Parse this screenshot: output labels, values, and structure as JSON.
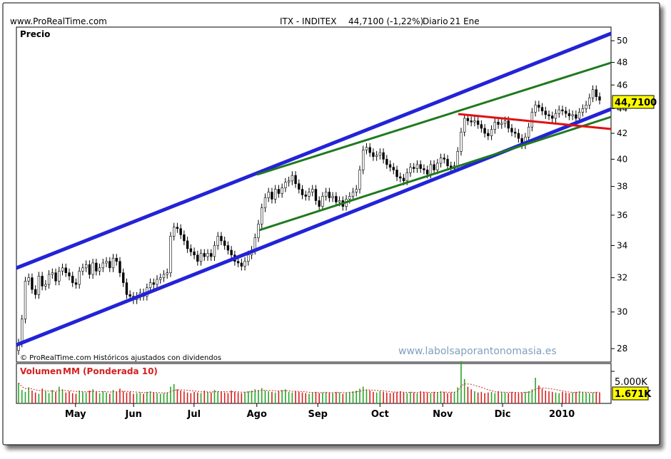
{
  "header": {
    "site": "www.ProRealTime.com",
    "title": "ITX - INDITEX",
    "quote": "44,7100 (-1,22%)",
    "period": "Diario",
    "date": "21 Ene"
  },
  "price_panel": {
    "label": "Precio",
    "footer_note": "© ProRealTime.com Históricos ajustados con dividendos",
    "watermark": "www.labolsaporantonomasia.es",
    "last_price_label": "44,7100"
  },
  "volume_panel": {
    "label_prefix": "Volumen",
    "label_ma": "MM (Ponderada 10)",
    "scale_top": "5.000K",
    "last_label": "1.671K"
  },
  "colors": {
    "up": "#2aa52a",
    "down": "#d42020",
    "channel_outer": "#2323d6",
    "channel_inner": "#1e7a1e",
    "resistance": "#e01010",
    "last_price_bg": "#ffff00"
  },
  "chart_data": [
    {
      "type": "candlestick",
      "title": "",
      "ylabel": "Precio",
      "yticks": [
        28,
        30,
        32,
        34,
        36,
        38,
        40,
        42,
        44,
        46,
        48,
        50
      ],
      "ylim": [
        27.3,
        51.3
      ],
      "y_scale": "log",
      "x_tick_labels": [
        "May",
        "Jun",
        "Jul",
        "Ago",
        "Sep",
        "Oct",
        "Nov",
        "Dic",
        "2010"
      ],
      "last_price": 44.71,
      "grid": false,
      "series": [
        {
          "values": [
            28.3,
            29.6,
            31.8,
            32.0,
            31.3,
            31.0,
            32.1,
            31.5,
            31.6,
            32.2,
            32.3,
            31.8,
            32.4,
            32.6,
            32.3,
            32.1,
            31.7,
            31.6,
            32.4,
            32.6,
            32.8,
            32.2,
            32.9,
            32.4,
            32.6,
            32.9,
            33.0,
            32.6,
            33.2,
            33.0,
            32.3,
            31.7,
            31.0,
            30.9,
            30.7,
            30.9,
            31.1,
            30.9,
            31.4,
            31.7,
            31.6,
            31.9,
            32.0,
            32.2,
            32.3,
            34.6,
            35.2,
            35.1,
            34.7,
            34.3,
            33.8,
            33.6,
            33.4,
            33.0,
            33.5,
            33.3,
            33.5,
            33.3,
            34.0,
            34.6,
            34.3,
            34.0,
            33.7,
            33.4,
            33.0,
            32.9,
            32.7,
            33.0,
            33.4,
            33.7,
            34.5,
            35.4,
            36.5,
            37.2,
            37.6,
            37.1,
            37.8,
            37.5,
            37.9,
            38.3,
            38.4,
            38.8,
            38.2,
            37.8,
            37.4,
            37.3,
            37.6,
            37.8,
            37.0,
            36.6,
            37.3,
            37.6,
            37.2,
            37.3,
            36.9,
            37.0,
            36.6,
            37.1,
            37.3,
            37.6,
            37.8,
            39.2,
            40.7,
            40.9,
            40.5,
            40.2,
            40.3,
            40.5,
            40.0,
            39.6,
            39.4,
            39.2,
            38.7,
            38.6,
            38.4,
            39.0,
            39.4,
            39.3,
            39.6,
            39.3,
            39.2,
            38.9,
            39.6,
            39.2,
            39.7,
            40.1,
            40.0,
            39.5,
            39.3,
            39.5,
            40.6,
            42.1,
            43.2,
            43.0,
            42.9,
            43.0,
            42.7,
            42.4,
            42.0,
            41.8,
            42.3,
            42.9,
            42.7,
            42.8,
            43.0,
            42.4,
            42.1,
            42.0,
            41.6,
            41.1,
            41.7,
            42.5,
            43.7,
            44.3,
            44.1,
            43.8,
            43.5,
            43.4,
            43.2,
            43.6,
            43.9,
            43.8,
            43.6,
            43.4,
            43.5,
            43.2,
            43.7,
            44.0,
            44.3,
            44.9,
            45.6,
            45.0,
            44.71
          ]
        }
      ]
    },
    {
      "type": "bar",
      "title": "",
      "ylabel": "Volumen",
      "ylim": [
        0,
        6000
      ],
      "yticks": [
        5000
      ],
      "unit": "K",
      "last_value": 1671,
      "series": [
        {
          "name": "MM (Ponderada 10)",
          "values": [
            3200,
            2100,
            1800,
            2500,
            2000,
            1700,
            1500,
            2300,
            1900,
            1600,
            2100,
            1800,
            2600,
            2200,
            1700,
            1900,
            1600,
            1500,
            2000,
            1800,
            1700,
            2000,
            2200,
            1800,
            1600,
            1900,
            1700,
            1500,
            2100,
            1800,
            2300,
            1900,
            1700,
            1800,
            1500,
            1600,
            1700,
            1500,
            1800,
            1900,
            1700,
            1600,
            1500,
            1600,
            1700,
            2600,
            3000,
            2200,
            2000,
            1900,
            1700,
            1600,
            1800,
            1700,
            1600,
            2000,
            1800,
            1700,
            2100,
            1900,
            1800,
            1700,
            1600,
            2000,
            1800,
            1700,
            1600,
            1800,
            1900,
            2000,
            2200,
            2100,
            2400,
            2000,
            1900,
            1800,
            1700,
            1900,
            2100,
            2200,
            1800,
            1700,
            1900,
            1800,
            1700,
            1600,
            1500,
            1700,
            1800,
            1600,
            1700,
            1800,
            1700,
            1600,
            1800,
            1700,
            1500,
            1700,
            1800,
            1900,
            2000,
            2300,
            2600,
            2200,
            2000,
            1800,
            1700,
            1900,
            1800,
            1700,
            1600,
            1700,
            1800,
            1900,
            1700,
            1600,
            1800,
            1700,
            1600,
            1900,
            1800,
            1700,
            1600,
            1800,
            1700,
            1900,
            1800,
            1600,
            1700,
            1800,
            2500,
            6600,
            3800,
            2600,
            2200,
            1900,
            1700,
            1800,
            1600,
            1700,
            1800,
            1600,
            1900,
            1800,
            1700,
            1600,
            1800,
            1700,
            1600,
            1700,
            1800,
            1900,
            2200,
            4000,
            2800,
            2300,
            2000,
            1900,
            1800,
            1700,
            1600,
            1800,
            1700,
            1600,
            1700,
            1800,
            1900,
            1800,
            1700,
            1600,
            1700,
            1800,
            1700,
            1671
          ]
        }
      ]
    }
  ]
}
